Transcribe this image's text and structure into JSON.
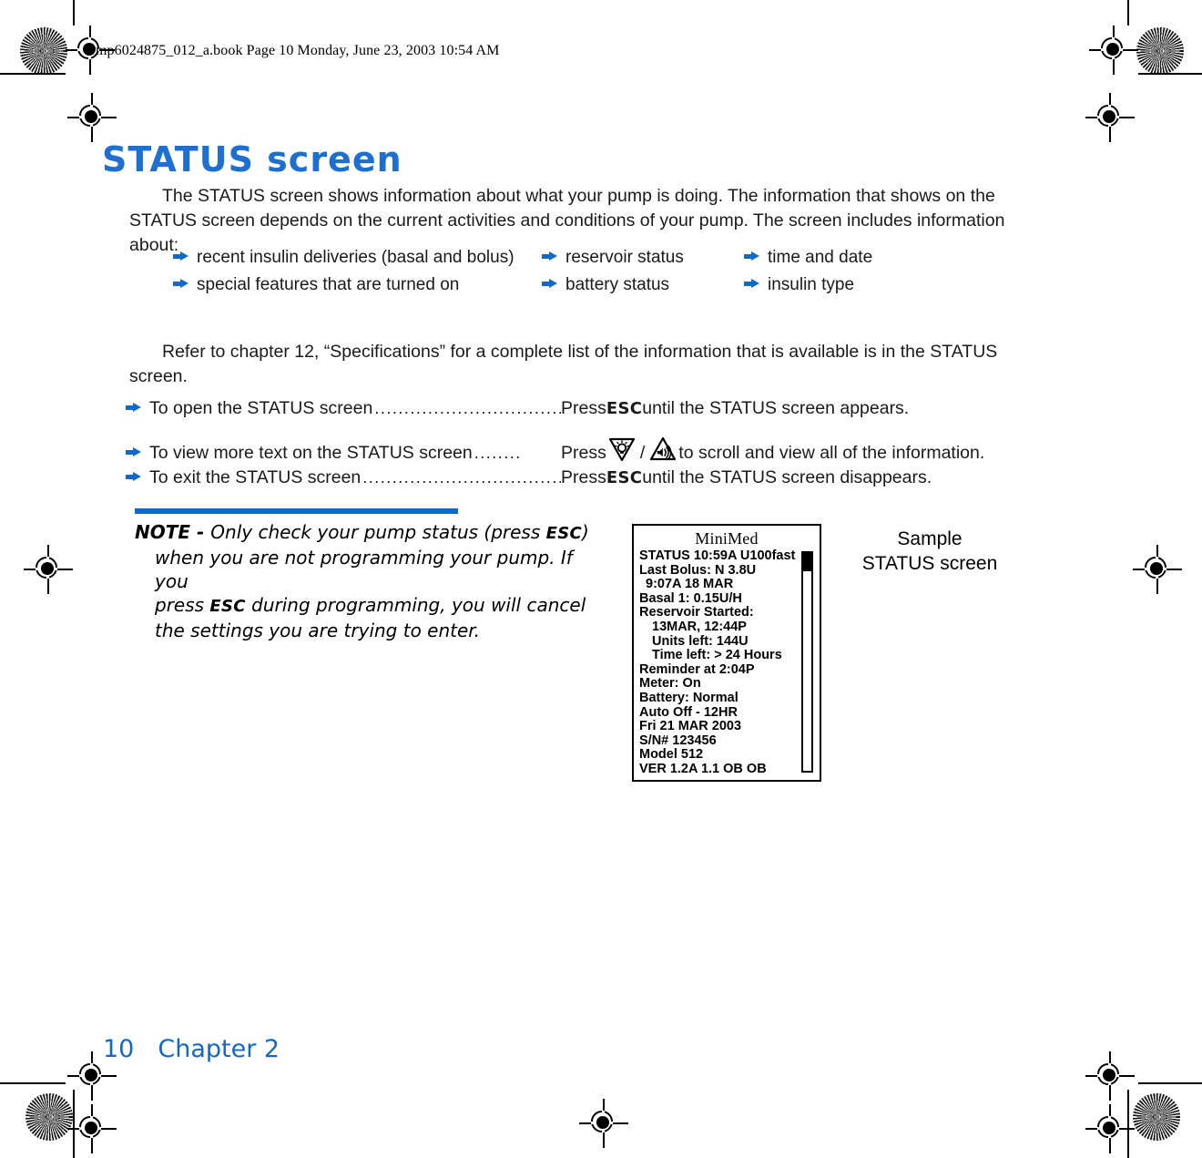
{
  "header": {
    "book_line": "mp6024875_012_a.book  Page 10  Monday, June 23, 2003  10:54 AM"
  },
  "heading": {
    "title": "STATUS screen",
    "color": "#1d6fd0"
  },
  "body": {
    "intro": "The STATUS screen shows information about what your pump is doing. The information that shows on the STATUS screen depends on the current activities and conditions of your pump. The screen includes information about:",
    "refer": "Refer to chapter 12, “Specifications” for a complete list of the information that is available is in the STATUS screen."
  },
  "bullets": {
    "column1": [
      "recent insulin deliveries (basal and bolus)",
      "special features that are turned on"
    ],
    "column2": [
      "reservoir status",
      "battery status"
    ],
    "column3": [
      "time and date",
      "insulin type"
    ]
  },
  "steps": [
    {
      "label": "To open the STATUS screen",
      "leader": "....................................",
      "action_pre": "Press ",
      "key": "ESC",
      "action_post": " until the STATUS screen appears.",
      "has_icons": false
    },
    {
      "label": "To view more text on the STATUS screen",
      "leader": "........",
      "action_pre": "Press ",
      "key": "",
      "action_post": " to scroll and view all of the information.",
      "has_icons": true,
      "icon_down": "backlight-down-button-icon",
      "icon_separator": "/",
      "icon_up": "sound-up-button-icon"
    },
    {
      "label": "To exit the STATUS screen",
      "leader": ".....................................",
      "action_pre": "Press ",
      "key": "ESC",
      "action_post": " until the STATUS screen disappears.",
      "has_icons": false
    }
  ],
  "note": {
    "rule_color": "#1268c8",
    "title": "NOTE - ",
    "line1_a": "Only check your pump status (press ",
    "line1_key": "ESC",
    "line1_b": ")",
    "line2": "when you are not programming your pump. If you",
    "line3_a": "press ",
    "line3_key": "ESC",
    "line3_b": " during programming, you will cancel",
    "line4": "the settings you are trying to enter."
  },
  "lcd": {
    "brand_main": "M",
    "brand_rest": "ini",
    "brand_m": "M",
    "brand_ed": "ed",
    "brand_full": "MiniMed",
    "lines": [
      {
        "text": "STATUS 10:59A U100fast",
        "indent": 0
      },
      {
        "text": "Last Bolus: N 3.8U",
        "indent": 0
      },
      {
        "text": "9:07A 18 MAR",
        "indent": 1
      },
      {
        "text": "Basal 1: 0.15U/H",
        "indent": 0
      },
      {
        "text": "Reservoir Started:",
        "indent": 0
      },
      {
        "text": "13MAR, 12:44P",
        "indent": 2
      },
      {
        "text": "Units left: 144U",
        "indent": 2
      },
      {
        "text": "Time left: > 24 Hours",
        "indent": 2
      },
      {
        "text": "Reminder at 2:04P",
        "indent": 0
      },
      {
        "text": "Meter: On",
        "indent": 0
      },
      {
        "text": "Battery: Normal",
        "indent": 0
      },
      {
        "text": "Auto Off - 12HR",
        "indent": 0
      },
      {
        "text": "Fri 21 MAR 2003",
        "indent": 0
      },
      {
        "text": "S/N# 123456",
        "indent": 0
      },
      {
        "text": "Model 512",
        "indent": 0
      },
      {
        "text": "VER 1.2A 1.1 OB OB",
        "indent": 0
      }
    ],
    "scroll_thumb_position": "top"
  },
  "caption": {
    "line1": "Sample",
    "line2": "STATUS screen"
  },
  "footer": {
    "page_number": "10",
    "chapter": "Chapter 2",
    "color": "#1268c8"
  }
}
